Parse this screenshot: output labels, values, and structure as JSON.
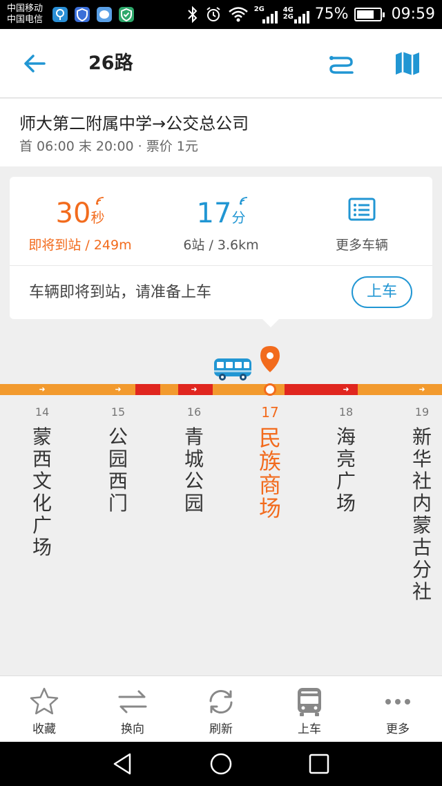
{
  "status_bar": {
    "carrier_1": "中国移动",
    "carrier_2": "中国电信",
    "net_top": "4G",
    "net_bottom": "2G",
    "net_mid": "2G",
    "battery_text": "75%",
    "battery_level": 0.75,
    "time": "09:59"
  },
  "header": {
    "title": "26路"
  },
  "route": {
    "name": "师大第二附属中学→公交总公司",
    "meta": "首 06:00 末 20:00 · 票价 1元"
  },
  "arrival": {
    "eta_value": "30",
    "eta_unit": "秒",
    "eta_status": "即将到站 / 249m",
    "next_value": "17",
    "next_unit": "分",
    "next_info": "6站 / 3.6km",
    "more_label": "更多车辆",
    "tip": "车辆即将到站，请准备上车",
    "board_label": "上车"
  },
  "stops": [
    {
      "num": "14",
      "name": "蒙西文化广场"
    },
    {
      "num": "15",
      "name": "公园西门"
    },
    {
      "num": "16",
      "name": "青城公园"
    },
    {
      "num": "17",
      "name": "民族商场"
    },
    {
      "num": "18",
      "name": "海亮广场"
    },
    {
      "num": "19",
      "name": "新华社内蒙古分社"
    }
  ],
  "tabs": {
    "favorite": "收藏",
    "reverse": "换向",
    "refresh": "刷新",
    "board": "上车",
    "more": "更多"
  },
  "colors": {
    "accent_blue": "#2196d3",
    "accent_orange": "#f26b1d",
    "line_orange": "#f29a2e",
    "line_red": "#e0261f"
  }
}
